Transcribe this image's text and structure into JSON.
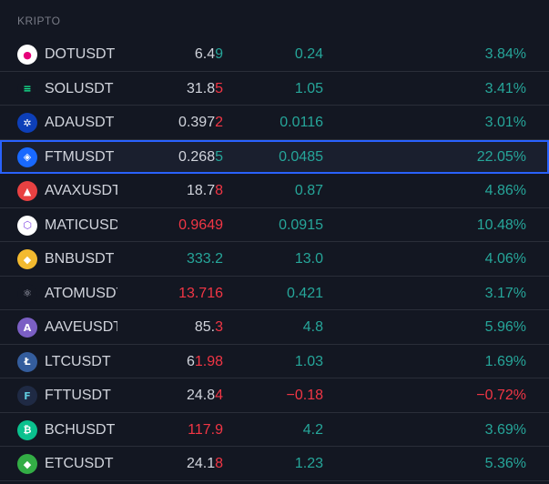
{
  "section_title": "KRIPTO",
  "colors": {
    "up": "#26a69a",
    "down": "#f23645",
    "neutral": "#d1d4dc",
    "selection": "#2962ff"
  },
  "rows": [
    {
      "symbol": "DOTUSDT",
      "last_main": "6.4",
      "last_tick": "9",
      "last_color": "neutral",
      "tick_color": "up",
      "change": "0.24",
      "change_color": "up",
      "pct": "3.84%",
      "pct_color": "up",
      "icon": "polkadot-icon",
      "icon_bg": "#ffffff",
      "icon_fg": "#e6007a",
      "icon_glyph": "●",
      "selected": false
    },
    {
      "symbol": "SOLUSDT",
      "last_main": "31.8",
      "last_tick": "5",
      "last_color": "neutral",
      "tick_color": "down",
      "change": "1.05",
      "change_color": "up",
      "pct": "3.41%",
      "pct_color": "up",
      "icon": "solana-icon",
      "icon_bg": "#131722",
      "icon_fg": "#14f195",
      "icon_glyph": "≡",
      "selected": false
    },
    {
      "symbol": "ADAUSDT",
      "last_main": "0.397",
      "last_tick": "2",
      "last_color": "neutral",
      "tick_color": "down",
      "change": "0.0116",
      "change_color": "up",
      "pct": "3.01%",
      "pct_color": "up",
      "icon": "cardano-icon",
      "icon_bg": "#0d3fb8",
      "icon_fg": "#ffffff",
      "icon_glyph": "✲",
      "selected": false
    },
    {
      "symbol": "FTMUSDT",
      "last_main": "0.268",
      "last_tick": "5",
      "last_color": "neutral",
      "tick_color": "up",
      "change": "0.0485",
      "change_color": "up",
      "pct": "22.05%",
      "pct_color": "up",
      "icon": "fantom-icon",
      "icon_bg": "#1969ff",
      "icon_fg": "#ffffff",
      "icon_glyph": "◈",
      "selected": true
    },
    {
      "symbol": "AVAXUSDT",
      "last_main": "18.7",
      "last_tick": "8",
      "last_color": "neutral",
      "tick_color": "down",
      "change": "0.87",
      "change_color": "up",
      "pct": "4.86%",
      "pct_color": "up",
      "icon": "avalanche-icon",
      "icon_bg": "#e84142",
      "icon_fg": "#ffffff",
      "icon_glyph": "▲",
      "selected": false
    },
    {
      "symbol": "MATICUSDT",
      "last_main": "0.9649",
      "last_tick": "",
      "last_color": "down",
      "tick_color": "down",
      "change": "0.0915",
      "change_color": "up",
      "pct": "10.48%",
      "pct_color": "up",
      "icon": "polygon-icon",
      "icon_bg": "#ffffff",
      "icon_fg": "#8247e5",
      "icon_glyph": "⬡",
      "selected": false
    },
    {
      "symbol": "BNBUSDT",
      "last_main": "333.2",
      "last_tick": "",
      "last_color": "up",
      "tick_color": "up",
      "change": "13.0",
      "change_color": "up",
      "pct": "4.06%",
      "pct_color": "up",
      "icon": "binance-icon",
      "icon_bg": "#f3ba2f",
      "icon_fg": "#ffffff",
      "icon_glyph": "◆",
      "selected": false
    },
    {
      "symbol": "ATOMUSDT",
      "last_main": "13.716",
      "last_tick": "",
      "last_color": "down",
      "tick_color": "down",
      "change": "0.421",
      "change_color": "up",
      "pct": "3.17%",
      "pct_color": "up",
      "icon": "cosmos-icon",
      "icon_bg": "#131722",
      "icon_fg": "#b7b9c9",
      "icon_glyph": "⚛",
      "selected": false
    },
    {
      "symbol": "AAVEUSDT",
      "last_main": "85.",
      "last_tick": "3",
      "last_color": "neutral",
      "tick_color": "down",
      "change": "4.8",
      "change_color": "up",
      "pct": "5.96%",
      "pct_color": "up",
      "icon": "aave-icon",
      "icon_bg": "#7b5fc4",
      "icon_fg": "#ffffff",
      "icon_glyph": "A",
      "selected": false
    },
    {
      "symbol": "LTCUSDT",
      "last_main": "6",
      "last_tick": "1.98",
      "last_color": "neutral",
      "tick_color": "down",
      "change": "1.03",
      "change_color": "up",
      "pct": "1.69%",
      "pct_color": "up",
      "icon": "litecoin-icon",
      "icon_bg": "#345d9d",
      "icon_fg": "#ffffff",
      "icon_glyph": "Ł",
      "selected": false
    },
    {
      "symbol": "FTTUSDT",
      "last_main": "24.8",
      "last_tick": "4",
      "last_color": "neutral",
      "tick_color": "down",
      "change": "−0.18",
      "change_color": "down",
      "pct": "−0.72%",
      "pct_color": "down",
      "icon": "ftx-icon",
      "icon_bg": "#1f2a44",
      "icon_fg": "#5fcade",
      "icon_glyph": "F",
      "selected": false
    },
    {
      "symbol": "BCHUSDT",
      "last_main": "117.9",
      "last_tick": "",
      "last_color": "down",
      "tick_color": "down",
      "change": "4.2",
      "change_color": "up",
      "pct": "3.69%",
      "pct_color": "up",
      "icon": "bitcoin-cash-icon",
      "icon_bg": "#0ac18e",
      "icon_fg": "#ffffff",
      "icon_glyph": "₿",
      "selected": false
    },
    {
      "symbol": "ETCUSDT",
      "last_main": "24.1",
      "last_tick": "8",
      "last_color": "neutral",
      "tick_color": "down",
      "change": "1.23",
      "change_color": "up",
      "pct": "5.36%",
      "pct_color": "up",
      "icon": "ethereum-classic-icon",
      "icon_bg": "#33ad45",
      "icon_fg": "#ffffff",
      "icon_glyph": "◆",
      "selected": false
    }
  ]
}
